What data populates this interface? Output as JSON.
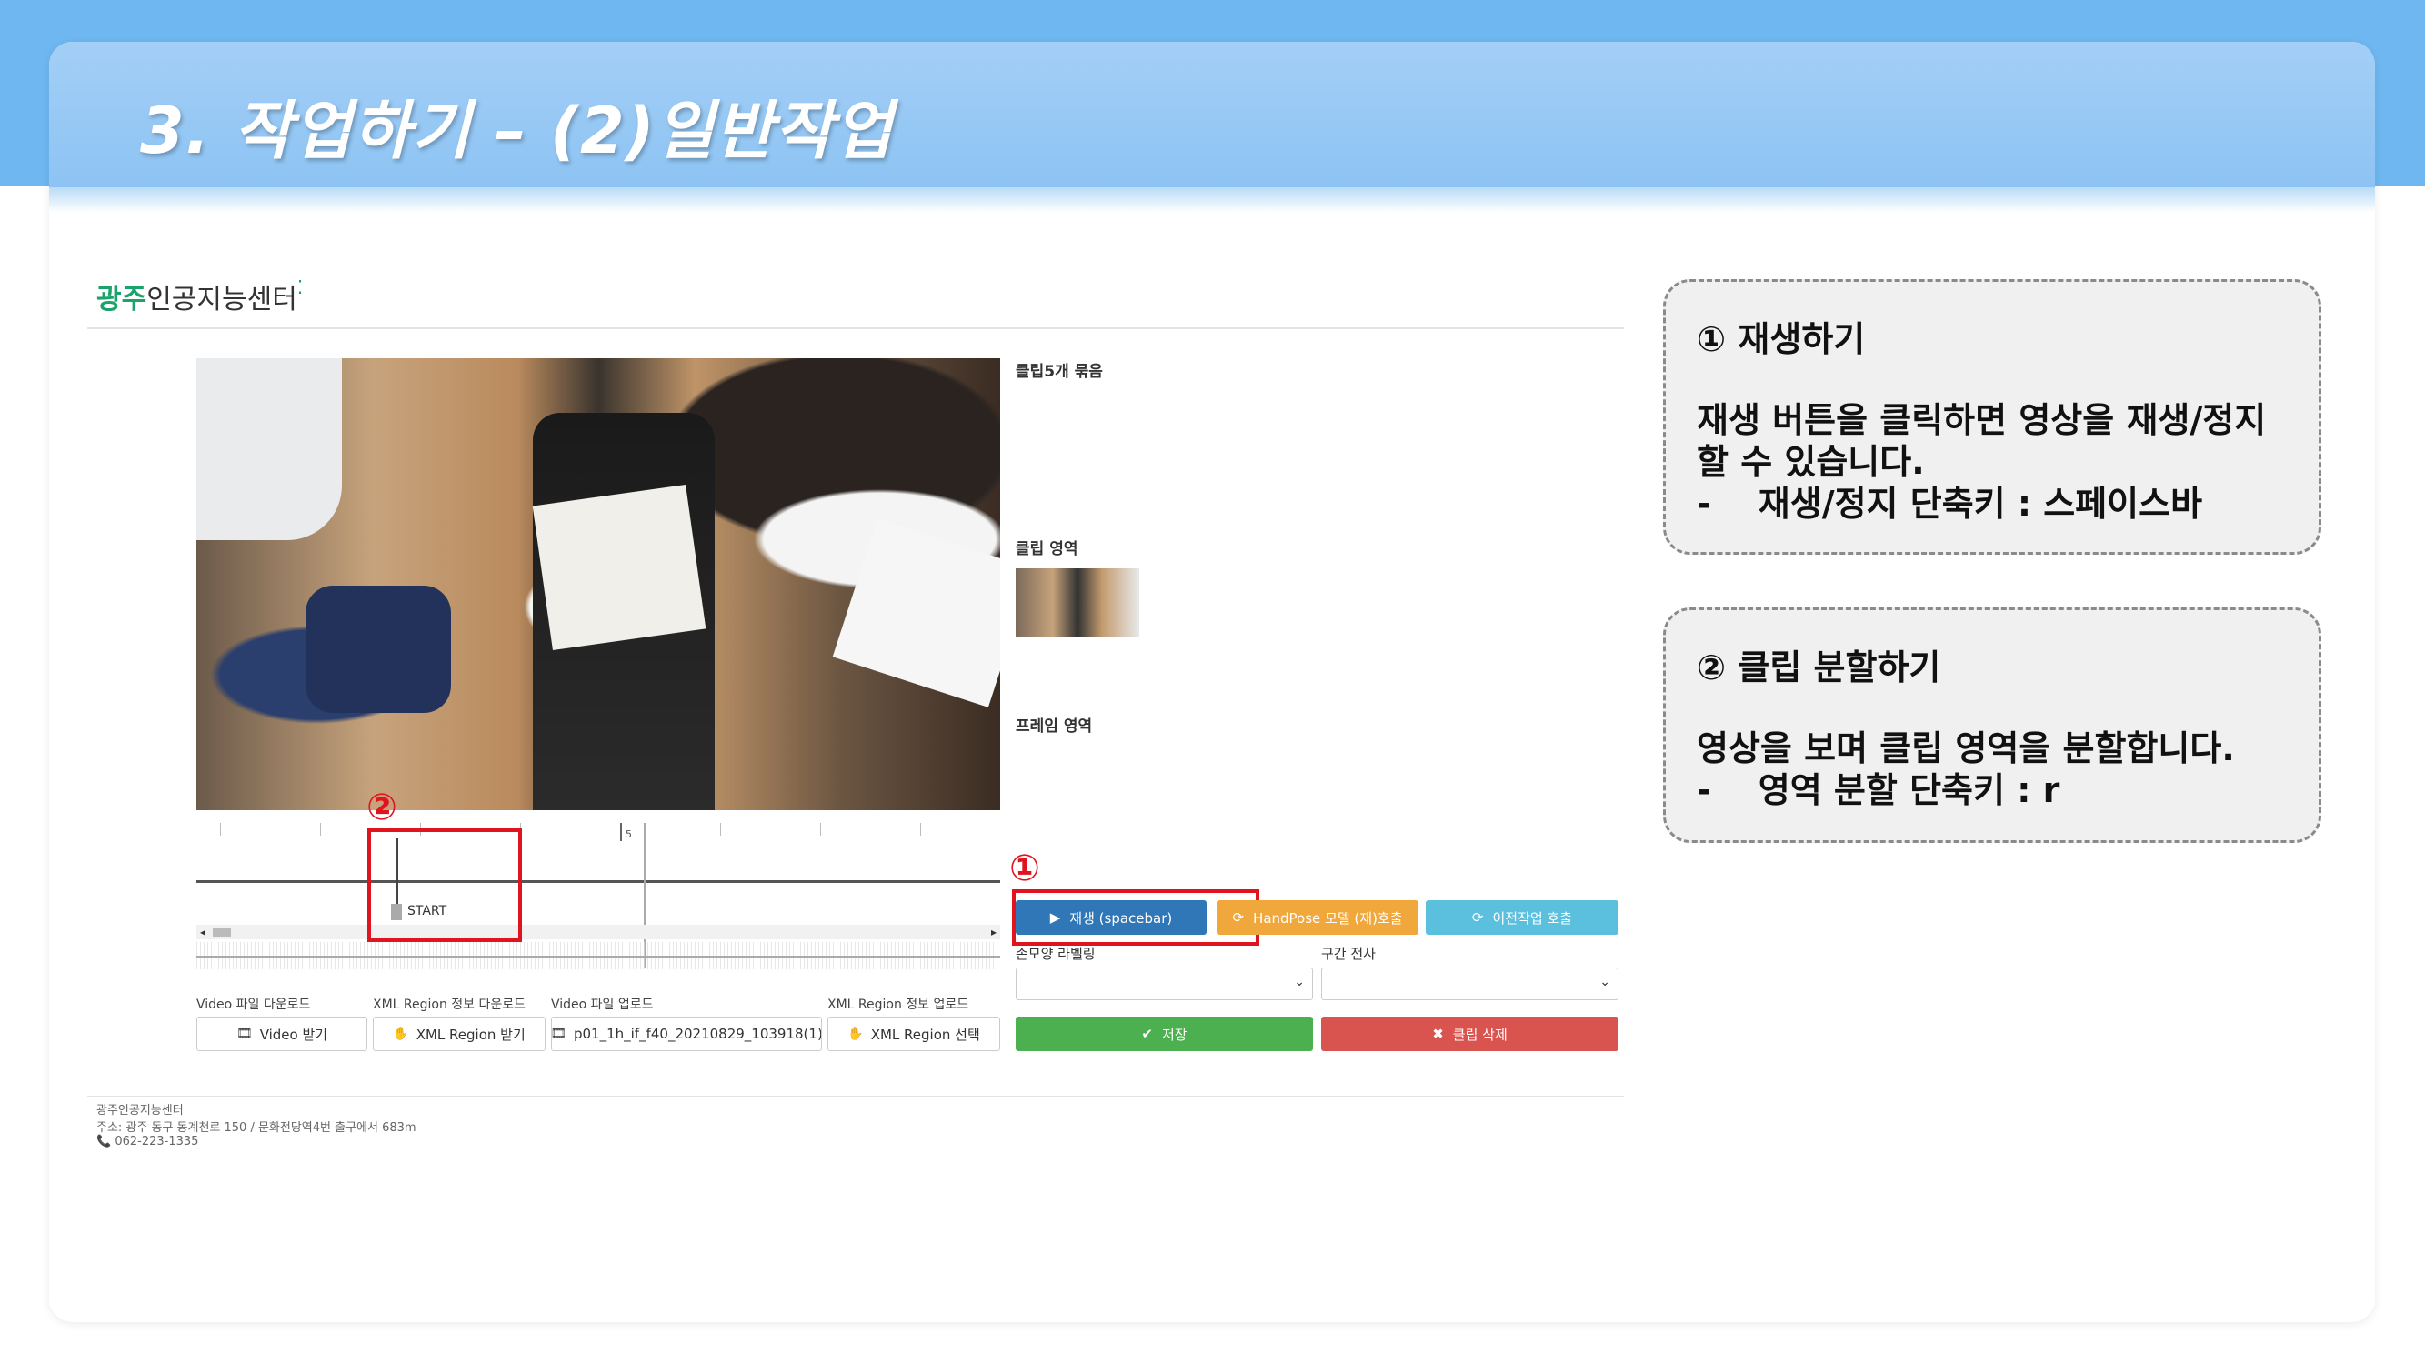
{
  "slide": {
    "title": "3. 작업하기 – (2)일반작업"
  },
  "app": {
    "logo_highlight": "광주",
    "logo_rest": "인공지능센터",
    "logo_dots": "⁚"
  },
  "side_panel": {
    "clip_group_label": "클립5개 묶음",
    "clip_area_label": "클립 영역",
    "frame_area_label": "프레임 영역"
  },
  "timeline": {
    "second_marker": "5",
    "start_label": "START"
  },
  "controls": {
    "play_button": "재생 (spacebar)",
    "handpose_button": "HandPose 모델 (재)호출",
    "prev_work_button": "이전작업 호출",
    "hand_label_label": "손모양 라벨링",
    "section_transcribe_label": "구간 전사",
    "save_button": "저장",
    "delete_clip_button": "클립 삭제"
  },
  "file_section": {
    "video_download_label": "Video 파일 다운로드",
    "xml_download_label": "XML Region 정보 다운로드",
    "video_upload_label": "Video 파일 업로드",
    "xml_upload_label": "XML Region 정보 업로드",
    "video_download_button": "Video 받기",
    "xml_download_button": "XML Region 받기",
    "video_upload_file": "p01_1h_if_f40_20210829_103918(1)",
    "xml_upload_button": "XML Region 선택"
  },
  "footer": {
    "org": "광주인공지능센터",
    "address": "주소: 광주 동구 동계천로 150 / 문화전당역4번 출구에서 683m",
    "phone": "062-223-1335"
  },
  "annotations": {
    "marker_1": "①",
    "marker_2": "②"
  },
  "callouts": [
    {
      "title": "① 재생하기",
      "body": "재생 버튼을 클릭하면 영상을 재생/정지할 수 있습니다.",
      "bullet_dash": "-",
      "bullet_text": "재생/정지 단축키 : 스페이스바"
    },
    {
      "title": "② 클립 분할하기",
      "body": "영상을 보며 클립 영역을 분할합니다.",
      "bullet_dash": "-",
      "bullet_text": "영역 분할 단축키 : r"
    }
  ],
  "colors": {
    "header_blue": "#8dc3f3",
    "play_blue": "#2f77b6",
    "handpose_orange": "#f0a83c",
    "prev_cyan": "#5bc0de",
    "save_green": "#4caf50",
    "delete_red": "#d9534f",
    "annotation_red": "#e0141e"
  }
}
